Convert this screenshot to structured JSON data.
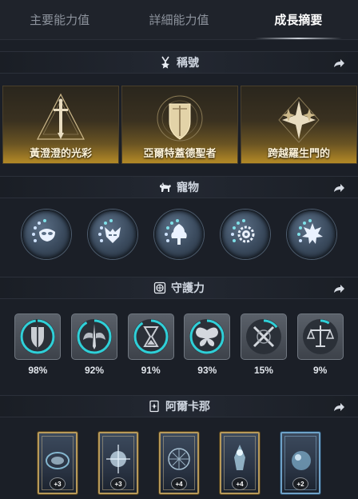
{
  "tabs": [
    {
      "label": "主要能力值",
      "active": false
    },
    {
      "label": "詳細能力值",
      "active": false
    },
    {
      "label": "成長摘要",
      "active": true
    }
  ],
  "sections": {
    "titles": {
      "label": "稱號"
    },
    "pets": {
      "label": "寵物"
    },
    "guardian": {
      "label": "守護力"
    },
    "arcana": {
      "label": "阿爾卡那"
    }
  },
  "title_cards": [
    {
      "label": "黃澄澄的光彩",
      "icon": "sword-triangle-emblem-icon"
    },
    {
      "label": "亞爾特蓋德聖者",
      "icon": "shield-circle-emblem-icon"
    },
    {
      "label": "跨越羅生門的",
      "icon": "star-diamond-emblem-icon"
    }
  ],
  "pets": [
    {
      "icon": "mask-emblem-icon"
    },
    {
      "icon": "wing-mask-emblem-icon"
    },
    {
      "icon": "tree-emblem-icon"
    },
    {
      "icon": "sun-gear-emblem-icon"
    },
    {
      "icon": "maple-leaf-emblem-icon"
    }
  ],
  "guardians": [
    {
      "percent": "98%",
      "progress": 0.98,
      "icon": "sword-shield-icon"
    },
    {
      "percent": "92%",
      "progress": 0.92,
      "icon": "winged-blade-icon"
    },
    {
      "percent": "91%",
      "progress": 0.91,
      "icon": "hourglass-icon"
    },
    {
      "percent": "93%",
      "progress": 0.93,
      "icon": "butterfly-icon"
    },
    {
      "percent": "15%",
      "progress": 0.15,
      "icon": "crossed-blades-icon"
    },
    {
      "percent": "9%",
      "progress": 0.09,
      "icon": "balance-scale-icon"
    }
  ],
  "arcana": [
    {
      "level": "+3",
      "frame": "gold"
    },
    {
      "level": "+3",
      "frame": "gold"
    },
    {
      "level": "+4",
      "frame": "gold"
    },
    {
      "level": "+4",
      "frame": "gold"
    },
    {
      "level": "+2",
      "frame": "blue"
    }
  ],
  "colors": {
    "accent_cyan": "#2fd0d8",
    "title_gold": "#b48a26",
    "background": "#1b1f27"
  }
}
